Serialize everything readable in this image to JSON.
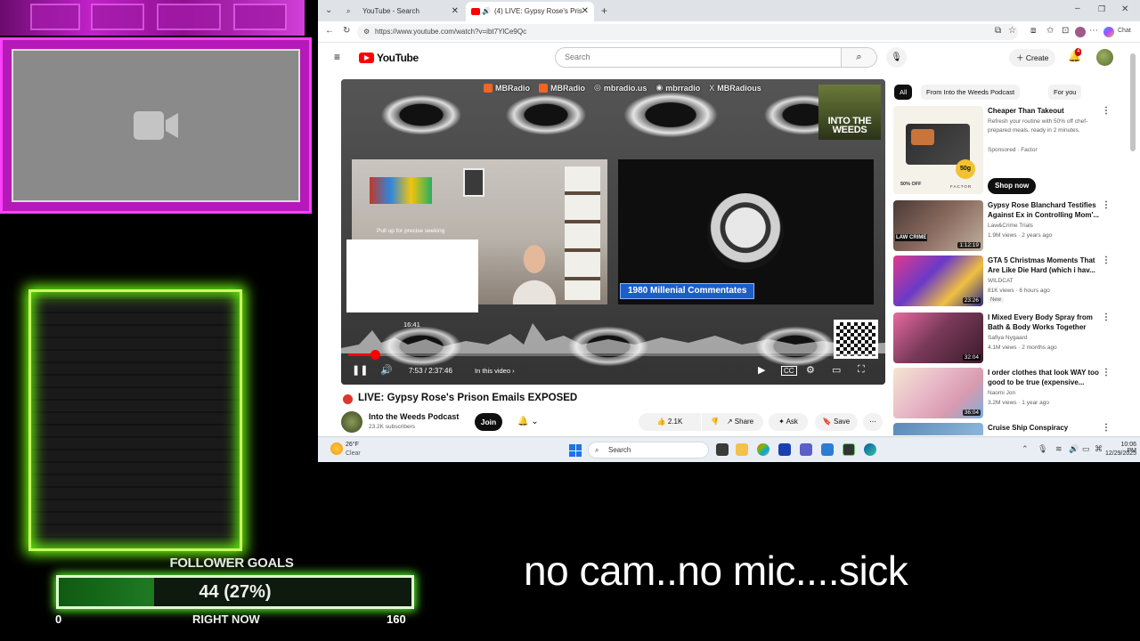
{
  "overlay": {
    "follower_goal_title": "FOLLOWER GOALS",
    "goal_progress_text": "44 (27%)",
    "goal_current": 44,
    "goal_fraction": 0.27,
    "goal_min": "0",
    "goal_now_label": "RIGHT NOW",
    "goal_max": "160",
    "caption": "no cam..no mic....sick",
    "accent_magenta": "#c022c8",
    "accent_green": "#70ff10"
  },
  "browser": {
    "tabs": [
      {
        "label": "YouTube - Search",
        "icon": "search-icon"
      },
      {
        "label": "(4) LIVE: Gypsy Rose's Pris",
        "icon": "youtube-icon"
      }
    ],
    "url": "https://www.youtube.com/watch?v=ibt7YlCe9Qc",
    "profile_label": "Chat"
  },
  "yt": {
    "logo": "YouTube",
    "search_placeholder": "Search",
    "create_label": "Create",
    "notif_count": "4"
  },
  "player": {
    "top_strip": [
      "MBRadio",
      "MBRadio",
      "mbradio.us",
      "mbrradio",
      "MBRadious"
    ],
    "logo_text": "INTO THE WEEDS",
    "seek_hint": "Pull up for precise seeking",
    "lower_third": "1980 Millenial Commentates",
    "hover_time": "16:41",
    "time": "7:53 / 2:37:46",
    "chapter": "In this video",
    "progress_fraction": 0.05
  },
  "video": {
    "title": "LIVE: Gypsy Rose's Prison Emails EXPOSED",
    "channel": "Into the Weeds Podcast",
    "subs": "23.2K subscribers",
    "join": "Join",
    "likes": "2.1K",
    "share": "Share",
    "ask": "Ask",
    "save": "Save"
  },
  "sidebar": {
    "chips": [
      "All",
      "From Into the Weeds Podcast",
      "For you"
    ],
    "ad": {
      "title": "Cheaper Than Takeout",
      "desc": "Refresh your routine with 50% off chef-prepared meals, ready in 2 minutes.",
      "sponsored": "Sponsored · Factor",
      "cta": "Shop now",
      "badge": "50g",
      "off": "50% OFF",
      "brand": "FACTOR"
    },
    "recs": [
      {
        "title": "Gypsy Rose Blanchard Testifies Against Ex in Controlling Mom'...",
        "channel": "Law&Crime Trials",
        "meta": "1.9M views · 2 years ago",
        "duration": "1:12:19",
        "new": ""
      },
      {
        "title": "GTA 5 Christmas Moments That Are Like Die Hard (which i hav...",
        "channel": "WILDCAT",
        "meta": "81K views · 6 hours ago",
        "duration": "23:26",
        "new": "New"
      },
      {
        "title": "I Mixed Every Body Spray from Bath & Body Works Together",
        "channel": "Safiya Nygaard",
        "meta": "4.1M views · 2 months ago",
        "duration": "32:04",
        "new": ""
      },
      {
        "title": "I order clothes that look WAY too good to be true (expensive...",
        "channel": "Naomi Jon",
        "meta": "3.2M views · 1 year ago",
        "duration": "36:04",
        "new": ""
      },
      {
        "title": "Cruise Ship Conspiracy",
        "channel": "",
        "meta": "",
        "duration": "",
        "new": ""
      }
    ]
  },
  "taskbar": {
    "temp": "26°F",
    "weather": "Clear",
    "search": "Search",
    "time": "10:06 PM",
    "date": "12/29/2025"
  }
}
